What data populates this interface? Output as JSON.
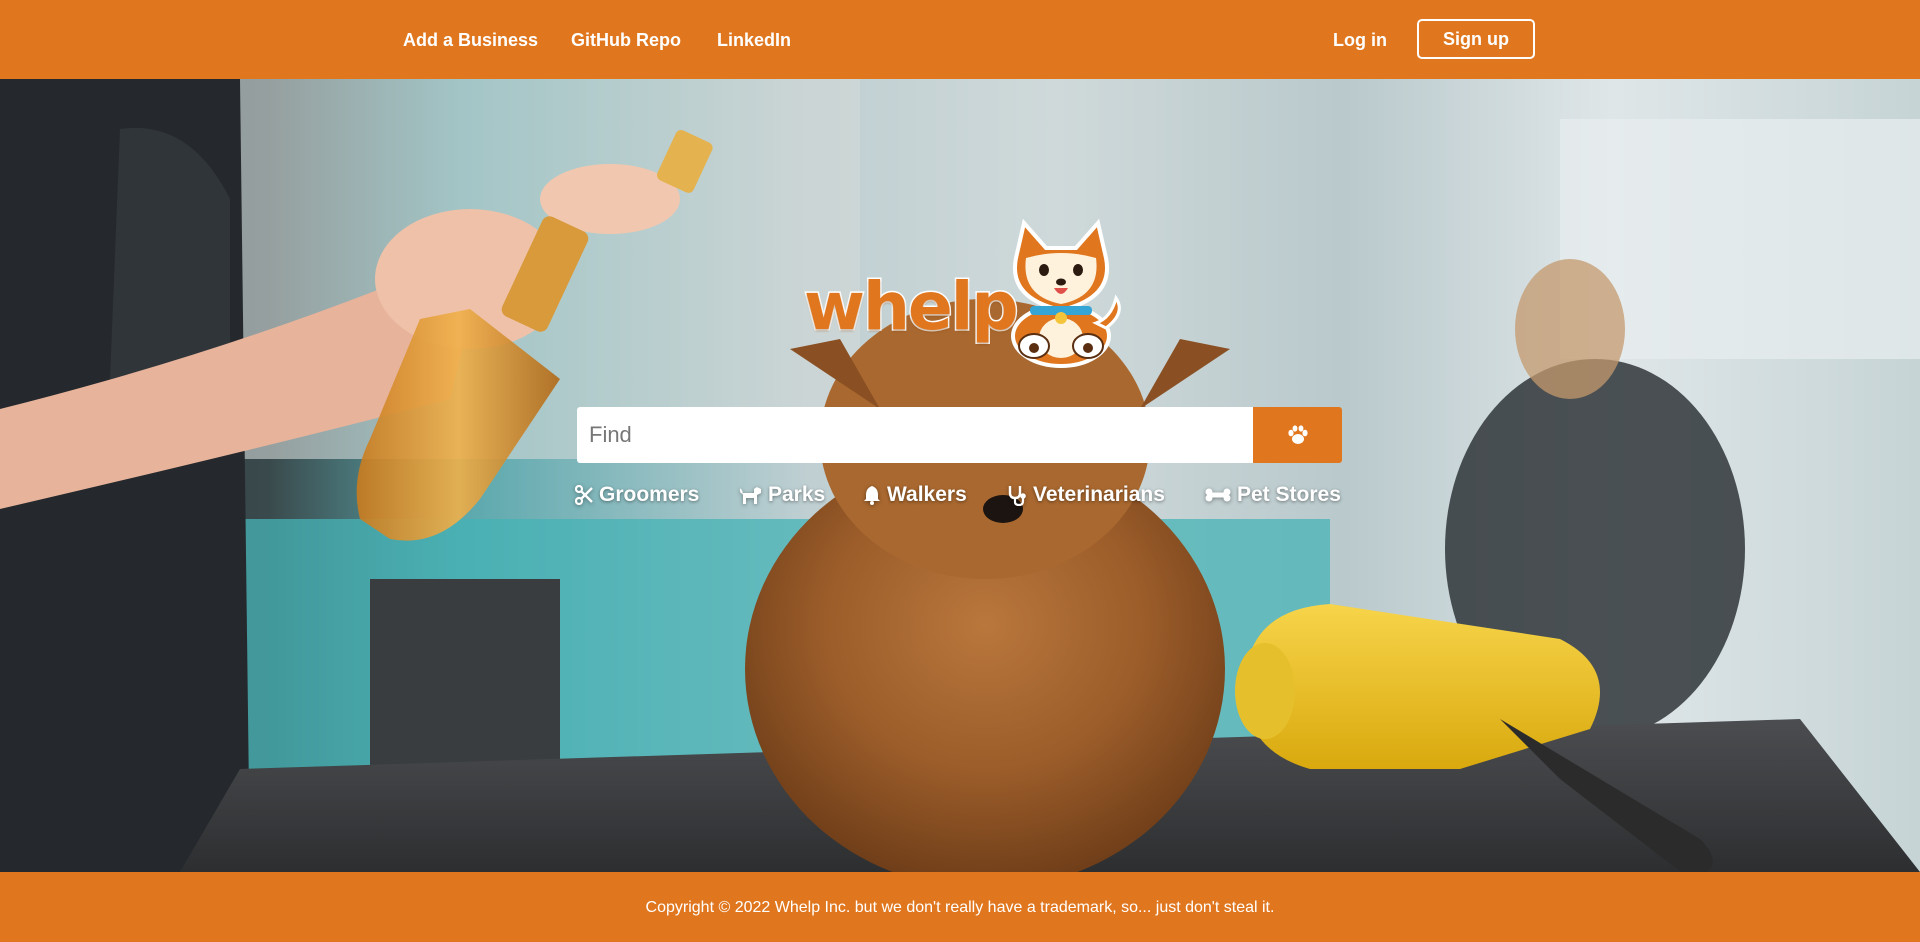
{
  "header": {
    "nav": {
      "add_business": "Add a Business",
      "github": "GitHub Repo",
      "linkedin": "LinkedIn"
    },
    "login_label": "Log in",
    "signup_label": "Sign up"
  },
  "logo": {
    "wordmark": "whelp",
    "mascot_icon": "shiba-dog-mascot-icon"
  },
  "search": {
    "placeholder": "Find",
    "button_icon": "paw-icon"
  },
  "categories": [
    {
      "label": "Groomers",
      "icon": "scissors-icon"
    },
    {
      "label": "Parks",
      "icon": "dog-icon"
    },
    {
      "label": "Walkers",
      "icon": "bell-icon"
    },
    {
      "label": "Veterinarians",
      "icon": "stethoscope-icon"
    },
    {
      "label": "Pet Stores",
      "icon": "bone-icon"
    }
  ],
  "footer": {
    "copyright": "Copyright © 2022 Whelp Inc. but we don't really have a trademark, so... just don't steal it."
  },
  "colors": {
    "brand_orange": "#E0771F",
    "text_light": "#FFFFFF"
  }
}
